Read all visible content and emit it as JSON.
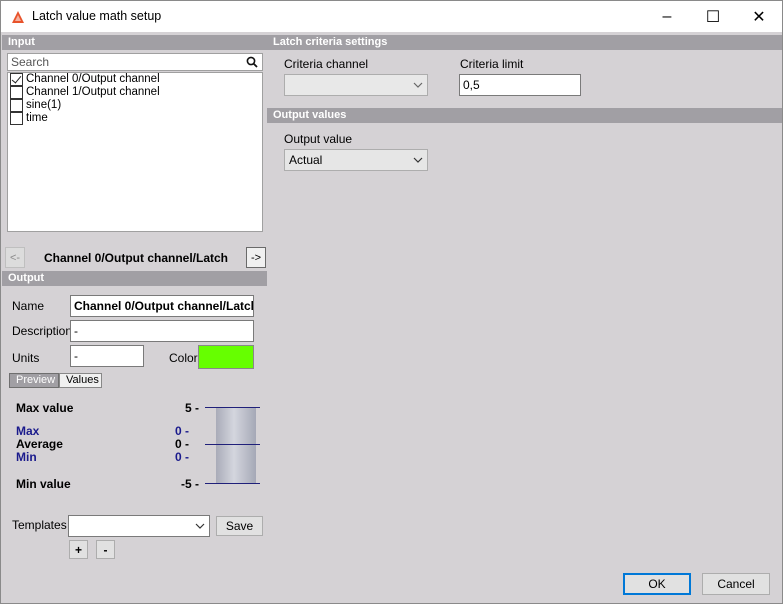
{
  "window": {
    "title": "Latch value math setup",
    "minimize_glyph": "–",
    "maximize_glyph": "☐",
    "close_glyph": "✕"
  },
  "input": {
    "header": "Input",
    "search_placeholder": "Search",
    "channels": [
      {
        "label": "Channel 0/Output channel",
        "checked": true
      },
      {
        "label": "Channel 1/Output channel",
        "checked": false
      },
      {
        "label": "sine(1)",
        "checked": false
      },
      {
        "label": "time",
        "checked": false
      }
    ]
  },
  "navigator": {
    "prev_label": "<-",
    "next_label": "->",
    "current": "Channel 0/Output channel/Latch"
  },
  "output": {
    "header": "Output",
    "name_label": "Name",
    "name_value": "Channel 0/Output channel/Latch",
    "description_label": "Description",
    "description_value": "-",
    "units_label": "Units",
    "units_value": "-",
    "color_label": "Color",
    "color_value": "#66ff00",
    "tabs": [
      "Preview",
      "Values"
    ]
  },
  "preview": {
    "max_value_label": "Max value",
    "max_value": "5 -",
    "max_label": "Max",
    "max": "0 -",
    "average_label": "Average",
    "average": "0 -",
    "min_label": "Min",
    "min": "0 -",
    "min_value_label": "Min value",
    "min_value": "-5 -"
  },
  "templates": {
    "label": "Templates",
    "selected": "",
    "save_label": "Save",
    "add_label": "+",
    "remove_label": "-"
  },
  "latch_criteria": {
    "header": "Latch criteria settings",
    "channel_label": "Criteria channel",
    "channel_value": "",
    "limit_label": "Criteria limit",
    "limit_value": "0,5"
  },
  "output_values": {
    "header": "Output values",
    "value_label": "Output value",
    "value_selected": "Actual"
  },
  "footer": {
    "ok_label": "OK",
    "cancel_label": "Cancel"
  }
}
